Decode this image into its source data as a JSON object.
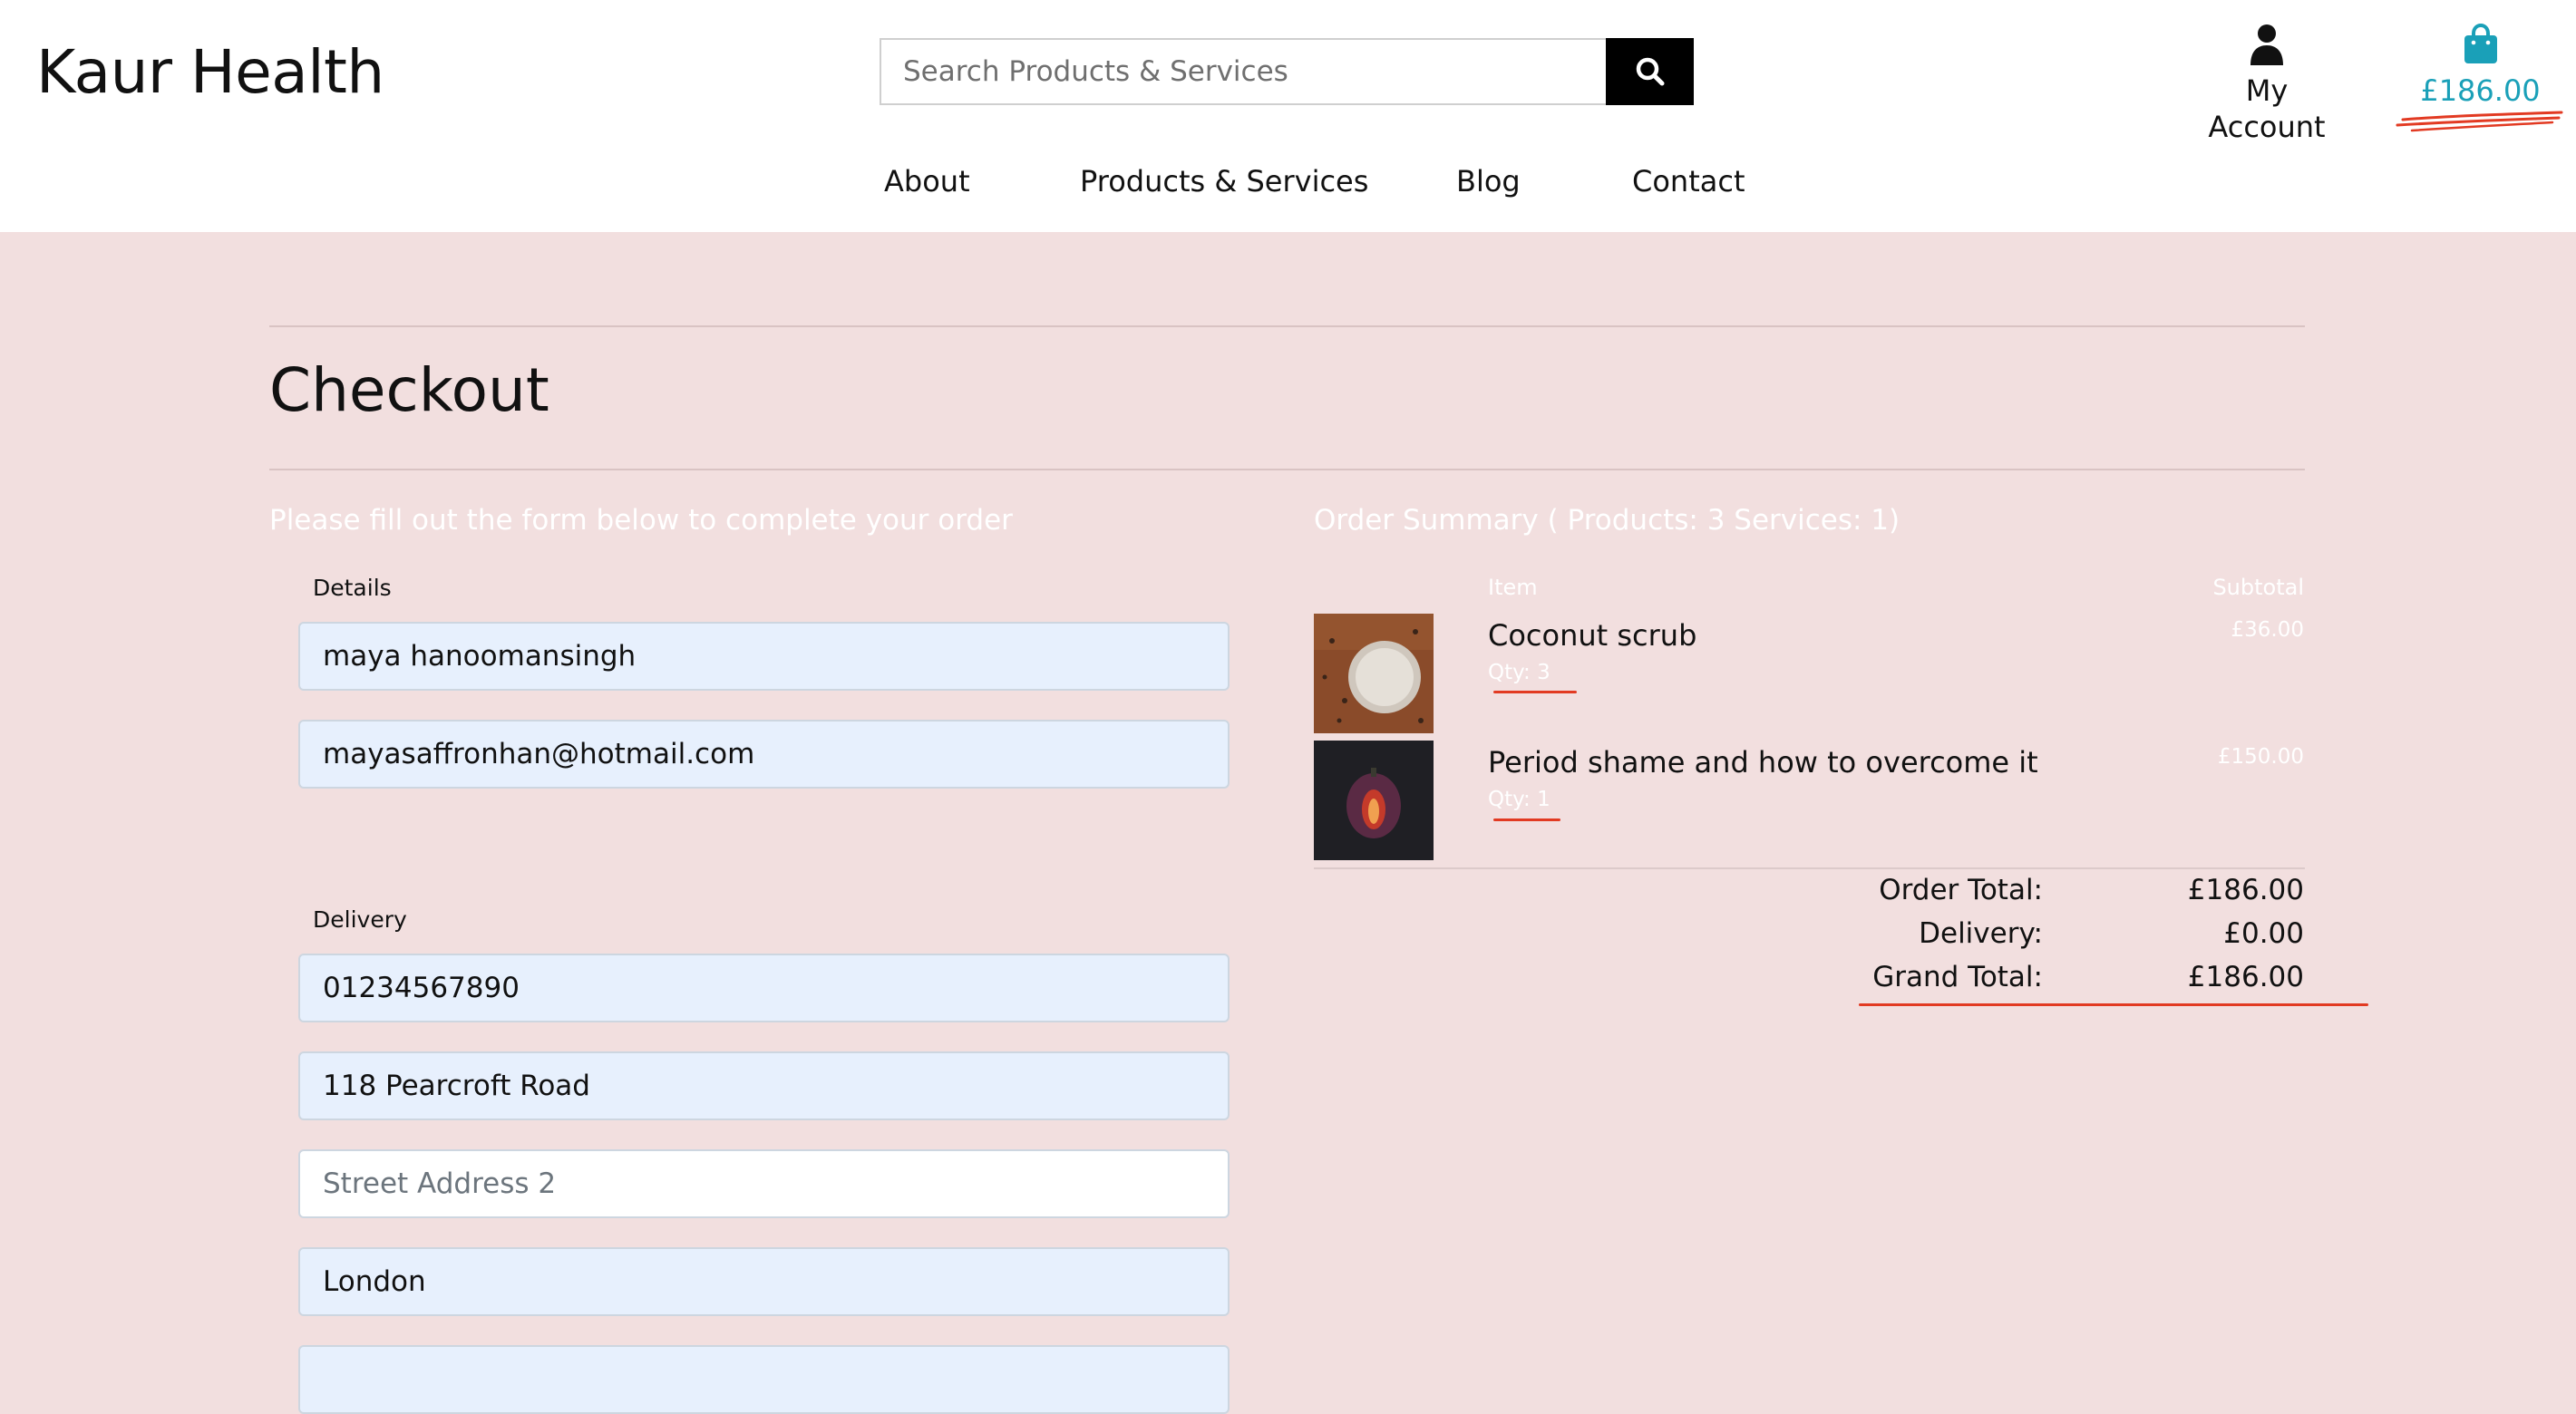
{
  "header": {
    "logo": "Kaur Health",
    "search_placeholder": "Search Products & Services",
    "account_label": "My Account",
    "bag_total": "£186.00",
    "search_icon": "search-icon",
    "account_icon": "user-icon",
    "bag_icon": "shopping-bag-icon"
  },
  "nav": {
    "items": [
      {
        "label": "About"
      },
      {
        "label": "Products & Services"
      },
      {
        "label": "Blog"
      },
      {
        "label": "Contact"
      }
    ]
  },
  "page": {
    "title": "Checkout",
    "form_intro": "Please fill out the form below to complete your order"
  },
  "form": {
    "details_label": "Details",
    "full_name": "maya hanoomansingh",
    "email": "mayasaffronhan@hotmail.com",
    "delivery_label": "Delivery",
    "phone": "01234567890",
    "street1": "118 Pearcroft Road",
    "street2_placeholder": "Street Address 2",
    "city": "London",
    "next_field_value": ""
  },
  "summary": {
    "title": "Order Summary ( Products: 3 Services: 1)",
    "col_item": "Item",
    "col_subtotal": "Subtotal",
    "items": [
      {
        "name": "Coconut scrub",
        "qty": "Qty: 3",
        "subtotal": "£36.00",
        "image": "coconut-scrub-image"
      },
      {
        "name": "Period shame and how to overcome it",
        "qty": "Qty: 1",
        "subtotal": "£150.00",
        "image": "fig-image"
      }
    ],
    "order_total_label": "Order Total:",
    "order_total": "£186.00",
    "delivery_label": "Delivery:",
    "delivery": "£0.00",
    "grand_total_label": "Grand Total:",
    "grand_total": "£186.00"
  },
  "colors": {
    "page_bg": "#f2dfdf",
    "accent_teal": "#1aa0b8",
    "annotation_red": "#e23a22",
    "field_autofill": "#e7f0fd"
  }
}
